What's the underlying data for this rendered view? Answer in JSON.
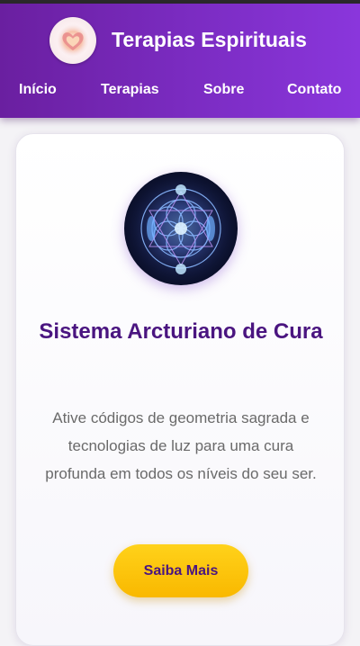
{
  "header": {
    "logo_icon": "heart-logo-icon",
    "title": "Terapias Espirituais",
    "gradient_start": "#6a1fa0",
    "gradient_end": "#8a36dc"
  },
  "nav": {
    "items": [
      {
        "label": "Início"
      },
      {
        "label": "Terapias"
      },
      {
        "label": "Sobre"
      },
      {
        "label": "Contato"
      }
    ]
  },
  "card": {
    "image_icon": "sacred-geometry-icon",
    "title": "Sistema Arcturiano de Cura",
    "description": "Ative códigos de geometria sagrada e tecnologias de luz para uma cura profunda em todos os níveis do seu ser.",
    "button_label": "Saiba Mais",
    "title_color": "#4a1580",
    "button_color": "#ffc400"
  }
}
